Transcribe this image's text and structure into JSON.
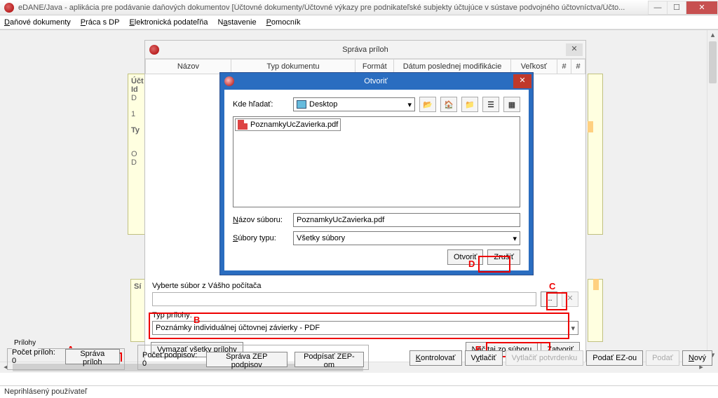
{
  "window": {
    "title": "eDANE/Java - aplikácia pre podávanie daňových dokumentov [Účtovné dokumenty/Účtovné výkazy pre podnikateľské subjekty účtujúce v sústave podvojného účtovníctva/Účto...",
    "min": "—",
    "max": "☐",
    "close": "✕"
  },
  "menu": {
    "danove": "Daňové dokumenty",
    "praca": "Práca s DP",
    "podatelna": "Elektronická podateľňa",
    "nastavenie": "Nastavenie",
    "pomocnik": "Pomocník"
  },
  "form_frag": {
    "id": "Id",
    "d": "D",
    "one": "1",
    "ty": "Ty",
    "o": "O",
    "dd": "D",
    "uc": "Účt",
    "si": "Sí"
  },
  "sprava": {
    "title": "Správa príloh",
    "cols": {
      "nazov": "Názov",
      "typ": "Typ dokumentu",
      "format": "Formát",
      "datum": "Dátum poslednej modifikácie",
      "velkost": "Veľkosť",
      "hash1": "#",
      "hash2": "#"
    },
    "choose_label": "Vyberte súbor z Vášho počítača",
    "browse": "...",
    "xbtn": "✕",
    "typ_label": "Typ prílohy:",
    "typ_value": "Poznámky individuálnej účtovnej závierky  - PDF",
    "vymazat": "Vymazať všetky prílohy",
    "nacitaj": "Načítaj zo súboru",
    "zatvorit": "Zatvoriť"
  },
  "open": {
    "title": "Otvoriť",
    "kde": "Kde hľadať:",
    "location": "Desktop",
    "file": "PoznamkyUcZavierka.pdf",
    "nazov_lbl": "Názov súboru:",
    "nazov_val": "PoznamkyUcZavierka.pdf",
    "typ_lbl": "Súbory typu:",
    "typ_val": "Všetky súbory",
    "otvorit": "Otvoriť",
    "zrusit": "Zrušiť",
    "close": "✕",
    "dd": "▾"
  },
  "tags": {
    "a": "A",
    "b": "B",
    "c": "C",
    "d": "D",
    "e": "E"
  },
  "prilohy": {
    "legend": "Prílohy",
    "count_lbl": "Počet príloh:",
    "count": "0",
    "sprava_btn": "Správa príloh"
  },
  "podpisy": {
    "count_lbl": "Počet podpisov:",
    "count": "0",
    "sprava_btn": "Správa ZEP podpisov",
    "podpisat": "Podpísať ZEP-om"
  },
  "actions": {
    "kontrolovat": "Kontrolovať",
    "vytlacit": "Vytlačiť",
    "potvrdenku": "Vytlačiť potvrdenku",
    "ezou": "Podať EZ-ou",
    "podat": "Podať",
    "novy": "Nový"
  },
  "status": "Neprihlásený používateľ"
}
